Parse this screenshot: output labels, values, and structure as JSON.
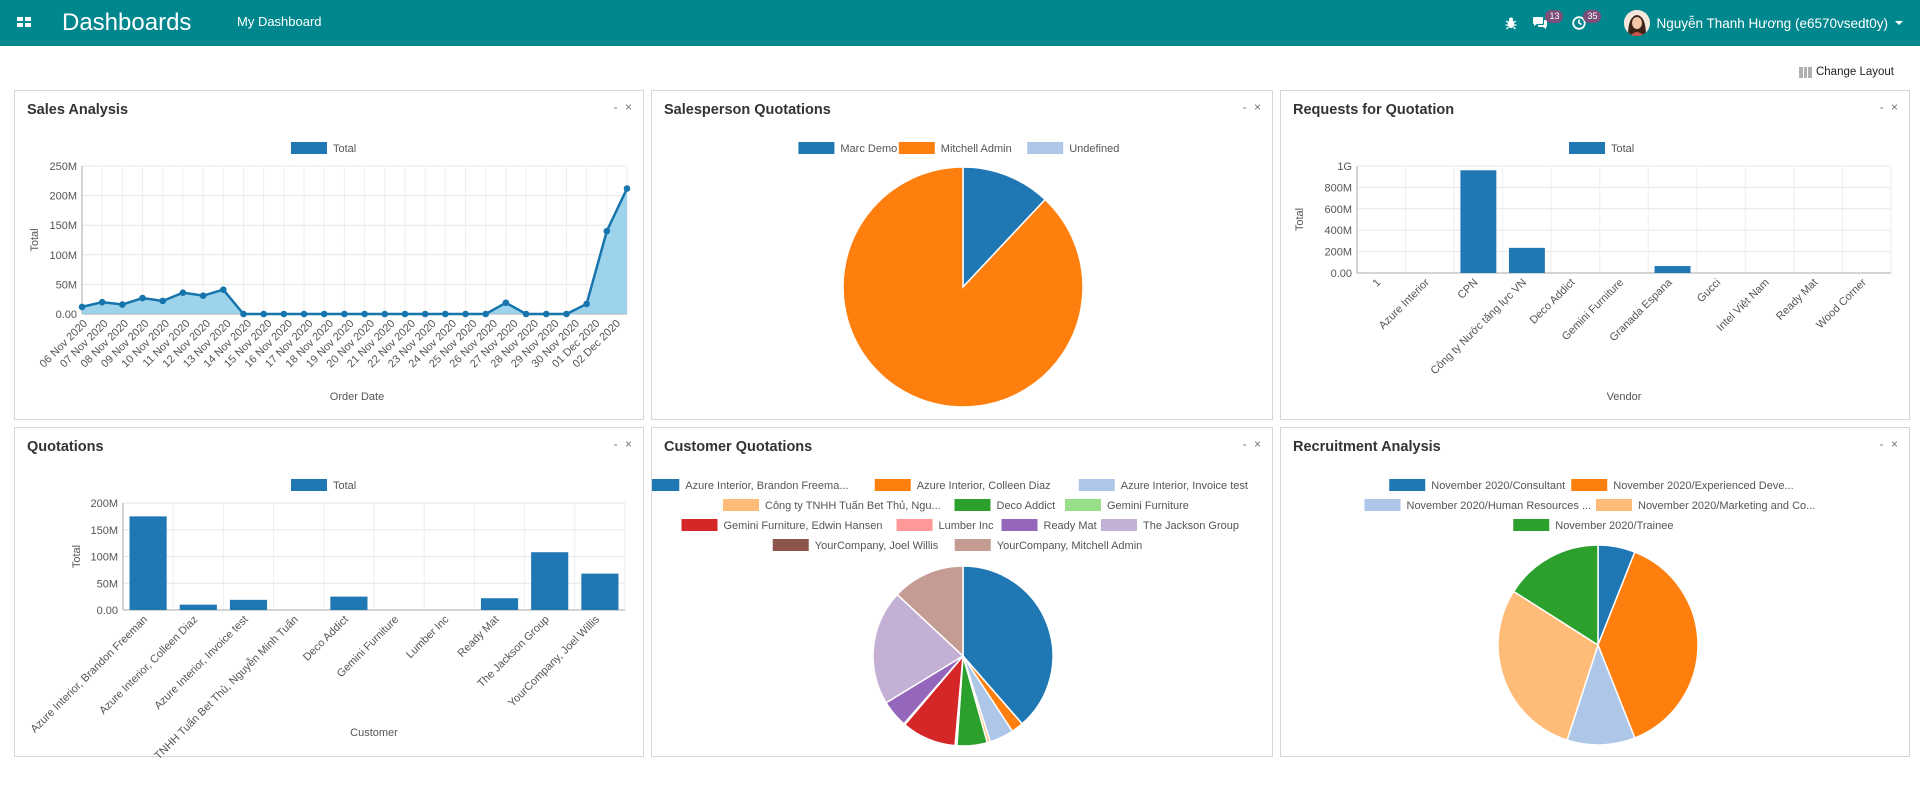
{
  "topbar": {
    "title": "Dashboards",
    "menu_item": "My Dashboard",
    "messages_count": "13",
    "activities_count": "35",
    "user_name": "Nguyễn Thanh Hương (e6570vsedt0y)"
  },
  "change_layout_label": "Change Layout",
  "colors": {
    "topbar": "#00878d",
    "blue": "#1f77b4",
    "orange": "#ff7f0e",
    "light_blue": "#aec7e8",
    "area_fill": "#8ccbe8"
  },
  "cards": {
    "sales_analysis": {
      "title": "Sales Analysis"
    },
    "salesperson_quotations": {
      "title": "Salesperson Quotations"
    },
    "requests_for_quotation": {
      "title": "Requests for Quotation"
    },
    "quotations": {
      "title": "Quotations"
    },
    "customer_quotations": {
      "title": "Customer Quotations"
    },
    "recruitment_analysis": {
      "title": "Recruitment Analysis"
    }
  },
  "chart_data": [
    {
      "id": "sales_analysis",
      "type": "line",
      "legend": [
        "Total"
      ],
      "xlabel": "Order Date",
      "ylabel": "Total",
      "ylim": [
        0,
        250
      ],
      "yticks": [
        "0.00",
        "50M",
        "100M",
        "150M",
        "200M",
        "250M"
      ],
      "categories": [
        "06 Nov 2020",
        "07 Nov 2020",
        "08 Nov 2020",
        "09 Nov 2020",
        "10 Nov 2020",
        "11 Nov 2020",
        "12 Nov 2020",
        "13 Nov 2020",
        "14 Nov 2020",
        "15 Nov 2020",
        "16 Nov 2020",
        "17 Nov 2020",
        "18 Nov 2020",
        "19 Nov 2020",
        "20 Nov 2020",
        "21 Nov 2020",
        "22 Nov 2020",
        "23 Nov 2020",
        "24 Nov 2020",
        "25 Nov 2020",
        "26 Nov 2020",
        "27 Nov 2020",
        "28 Nov 2020",
        "29 Nov 2020",
        "30 Nov 2020",
        "01 Dec 2020",
        "02 Dec 2020"
      ],
      "series": [
        {
          "name": "Total",
          "values": [
            12,
            20,
            16,
            27,
            22,
            36,
            31,
            41,
            0,
            0,
            0,
            0,
            0,
            0,
            0,
            0,
            0,
            0,
            0,
            0,
            0,
            19,
            0,
            0,
            0,
            17,
            140,
            212
          ]
        }
      ],
      "grid": true,
      "legend_position": "top"
    },
    {
      "id": "salesperson_quotations",
      "type": "pie",
      "labels": [
        "Marc Demo",
        "Mitchell Admin",
        "Undefined"
      ],
      "values": [
        12,
        88,
        0
      ],
      "colors": [
        "#1f77b4",
        "#ff7f0e",
        "#aec7e8"
      ],
      "legend_position": "top"
    },
    {
      "id": "requests_for_quotation",
      "type": "bar",
      "legend": [
        "Total"
      ],
      "xlabel": "Vendor",
      "ylabel": "Total",
      "ylim": [
        0,
        1000
      ],
      "yticks": [
        "0.00",
        "200M",
        "400M",
        "600M",
        "800M",
        "1G"
      ],
      "categories": [
        "1",
        "Azure Interior",
        "CPN",
        "Công ty Nước tăng lực VN",
        "Deco Addict",
        "Gemini Furniture",
        "Granada Espana",
        "Gucci",
        "Intel Việt Nam",
        "Ready Mat",
        "Wood Corner"
      ],
      "values": [
        0,
        0,
        960,
        235,
        0,
        0,
        65,
        0,
        0,
        0,
        0
      ],
      "grid": true,
      "legend_position": "top"
    },
    {
      "id": "quotations",
      "type": "bar",
      "legend": [
        "Total"
      ],
      "xlabel": "Customer",
      "ylabel": "Total",
      "ylim": [
        0,
        200
      ],
      "yticks": [
        "0.00",
        "50M",
        "100M",
        "150M",
        "200M"
      ],
      "categories": [
        "Azure Interior, Brandon Freeman",
        "Azure Interior, Colleen Diaz",
        "Azure Interior, Invoice test",
        "Công ty TNHH Tuấn Bet Thủ, Nguyễn Minh Tuấn",
        "Deco Addict",
        "Gemini Furniture",
        "Lumber Inc",
        "Ready Mat",
        "The Jackson Group",
        "YourCompany, Joel Willis"
      ],
      "values": [
        175,
        10,
        19,
        0,
        25,
        0,
        0,
        22,
        108,
        68
      ],
      "grid": true,
      "legend_position": "top"
    },
    {
      "id": "customer_quotations",
      "type": "pie",
      "labels": [
        "Azure Interior, Brandon Freema...",
        "Azure Interior, Colleen Diaz",
        "Azure Interior, Invoice test",
        "Công ty TNHH Tuấn Bet Thủ, Ngu...",
        "Deco Addict",
        "Gemini Furniture",
        "Gemini Furniture, Edwin Hansen",
        "Lumber Inc",
        "Ready Mat",
        "The Jackson Group",
        "YourCompany, Joel Willis",
        "YourCompany, Mitchell Admin"
      ],
      "values": [
        35.5,
        2.0,
        4.0,
        0.5,
        5.0,
        0.3,
        9.0,
        0.2,
        4.5,
        19.0,
        0,
        12.0
      ],
      "colors": [
        "#1f77b4",
        "#ff7f0e",
        "#aec7e8",
        "#ffbb78",
        "#2ca02c",
        "#98df8a",
        "#d62728",
        "#ff9896",
        "#9467bd",
        "#c5b0d5",
        "#8c564b",
        "#c49c94"
      ],
      "legend_position": "top"
    },
    {
      "id": "recruitment_analysis",
      "type": "pie",
      "labels": [
        "November 2020/Consultant",
        "November 2020/Experienced Deve...",
        "November 2020/Human Resources ...",
        "November 2020/Marketing and Co...",
        "November 2020/Trainee"
      ],
      "values": [
        6,
        38,
        11,
        29,
        16
      ],
      "colors": [
        "#1f77b4",
        "#ff7f0e",
        "#aec7e8",
        "#ffbb78",
        "#2ca02c"
      ],
      "legend_position": "top"
    }
  ]
}
